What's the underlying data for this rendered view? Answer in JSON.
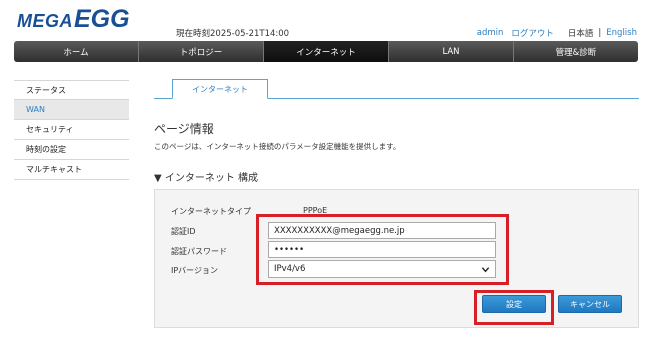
{
  "header": {
    "logo_mega": "MEGA",
    "logo_egg": "EGG",
    "time_text": "現在時刻2025-05-21T14:00",
    "user_link": "admin",
    "logout_link": "ログアウト",
    "lang_current": "日本語",
    "lang_sep": "|",
    "lang_english": "English"
  },
  "nav": {
    "items": [
      "ホーム",
      "トポロジー",
      "インターネット",
      "LAN",
      "管理&診断"
    ],
    "active_index": 2
  },
  "sidebar": {
    "items": [
      "ステータス",
      "WAN",
      "セキュリティ",
      "時刻の設定",
      "マルチキャスト"
    ],
    "active_index": 1
  },
  "tab": {
    "label": "インターネット"
  },
  "page": {
    "title": "ページ情報",
    "description": "このページは、インターネット接続のパラメータ設定機能を提供します。",
    "section_title": "▼ インターネット 構成"
  },
  "form": {
    "internet_type_label": "インターネットタイプ",
    "internet_type_value": "PPPoE",
    "auth_id_label": "認証ID",
    "auth_id_value": "XXXXXXXXXX@megaegg.ne.jp",
    "auth_pw_label": "認証パスワード",
    "auth_pw_value": "••••••",
    "ip_version_label": "IPバージョン",
    "ip_version_value": "IPv4/v6"
  },
  "buttons": {
    "set": "設定",
    "cancel": "キャンセル"
  },
  "colors": {
    "brand": "#1a4f95",
    "link": "#2f7fc1",
    "highlight": "#d61f26",
    "button": "#2178c1"
  }
}
